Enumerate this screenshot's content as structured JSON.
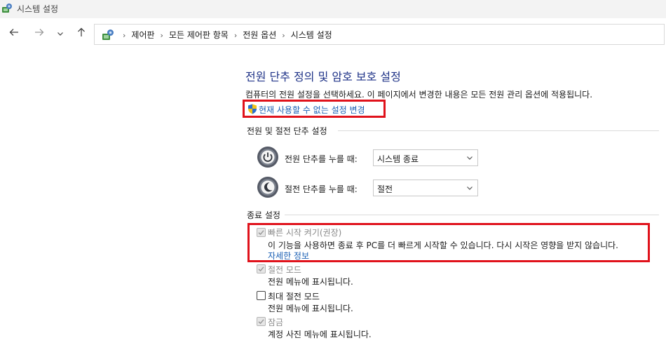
{
  "window": {
    "title": "시스템 설정"
  },
  "nav": {
    "back_icon": "arrow-left-icon",
    "forward_icon": "arrow-right-icon",
    "recent_icon": "chevron-down-icon",
    "up_icon": "arrow-up-icon"
  },
  "breadcrumb": {
    "separator": "›",
    "items": [
      "제어판",
      "모든 제어판 항목",
      "전원 옵션",
      "시스템 설정"
    ]
  },
  "main": {
    "title": "전원 단추 정의 및 암호 보호 설정",
    "description": "컴퓨터의 전원 설정을 선택하세요. 이 페이지에서 변경한 내용은 모든 전원 관리 옵션에 적용됩니다.",
    "admin_link": "현재 사용할 수 없는 설정 변경",
    "power_section": {
      "heading": "전원 및 절전 단추 설정",
      "rows": [
        {
          "label": "전원 단추를 누를 때:",
          "value": "시스템 종료",
          "icon": "power-button-icon"
        },
        {
          "label": "절전 단추를 누를 때:",
          "value": "절전",
          "icon": "sleep-button-icon"
        }
      ]
    },
    "shutdown_section": {
      "heading": "종료 설정",
      "options": [
        {
          "label": "빠른 시작 켜기(권장)",
          "checked": true,
          "enabled": false,
          "description": "이 기능을 사용하면 종료 후 PC를 더 빠르게 시작할 수 있습니다. 다시 시작은 영향을 받지 않습니다.",
          "link": "자세한 정보"
        },
        {
          "label": "절전 모드",
          "checked": true,
          "enabled": false,
          "description": "전원 메뉴에 표시됩니다."
        },
        {
          "label": "최대 절전 모드",
          "checked": false,
          "enabled": true,
          "description": "전원 메뉴에 표시됩니다."
        },
        {
          "label": "잠금",
          "checked": true,
          "enabled": false,
          "description": "계정 사진 메뉴에 표시됩니다."
        }
      ]
    }
  },
  "colors": {
    "title_blue": "#1e3287",
    "link_blue": "#1a5fb4",
    "highlight_red": "#e0121b"
  }
}
